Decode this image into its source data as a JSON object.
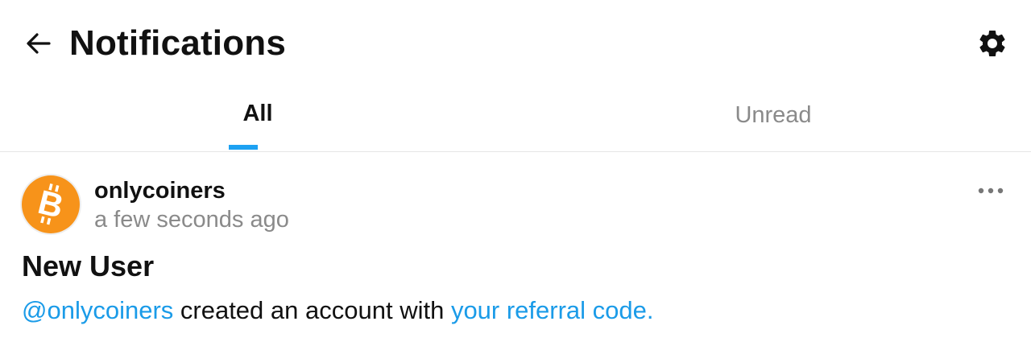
{
  "header": {
    "title": "Notifications",
    "back_icon": "arrow-left-icon",
    "settings_icon": "gear-icon"
  },
  "tabs": [
    {
      "label": "All",
      "active": true
    },
    {
      "label": "Unread",
      "active": false
    }
  ],
  "colors": {
    "accent": "#1da1f2",
    "link": "#1a9be8",
    "bitcoin_orange": "#f7931a",
    "muted_text": "#8a8a8a"
  },
  "notification": {
    "avatar_icon": "bitcoin-logo-icon",
    "author": "onlycoiners",
    "time": "a few seconds ago",
    "more_icon": "more-horizontal-icon",
    "title": "New User",
    "mention": "@onlycoiners",
    "body_text": " created an account with ",
    "referral_link": "your referral code."
  }
}
